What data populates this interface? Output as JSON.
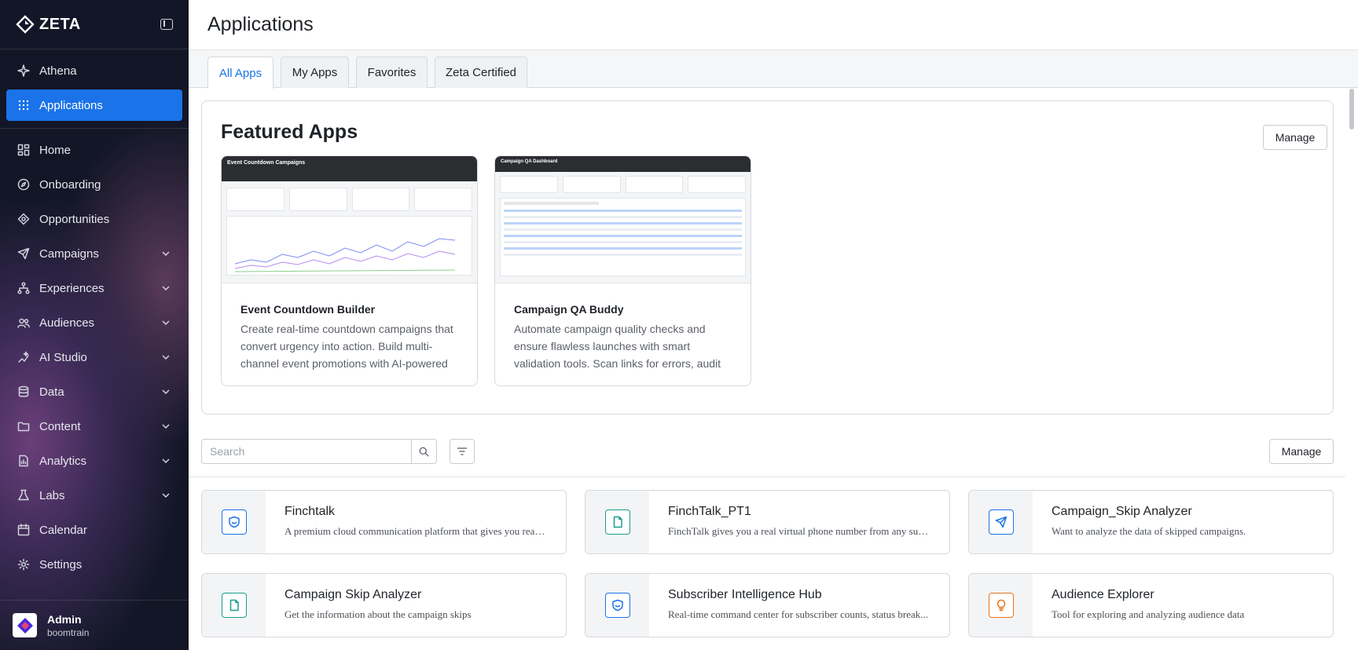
{
  "brand": {
    "name": "ZETA"
  },
  "sidebar": {
    "items": [
      {
        "label": "Athena",
        "icon": "sparkle-icon",
        "active": false,
        "expandable": false
      },
      {
        "label": "Applications",
        "icon": "grid-icon",
        "active": true,
        "expandable": false
      },
      {
        "label": "Home",
        "icon": "dashboard-icon",
        "active": false,
        "expandable": false
      },
      {
        "label": "Onboarding",
        "icon": "compass-icon",
        "active": false,
        "expandable": false
      },
      {
        "label": "Opportunities",
        "icon": "target-icon",
        "active": false,
        "expandable": false
      },
      {
        "label": "Campaigns",
        "icon": "send-icon",
        "active": false,
        "expandable": true
      },
      {
        "label": "Experiences",
        "icon": "flow-icon",
        "active": false,
        "expandable": true
      },
      {
        "label": "Audiences",
        "icon": "users-icon",
        "active": false,
        "expandable": true
      },
      {
        "label": "AI Studio",
        "icon": "ai-icon",
        "active": false,
        "expandable": true
      },
      {
        "label": "Data",
        "icon": "database-icon",
        "active": false,
        "expandable": true
      },
      {
        "label": "Content",
        "icon": "folder-icon",
        "active": false,
        "expandable": true
      },
      {
        "label": "Analytics",
        "icon": "report-icon",
        "active": false,
        "expandable": true
      },
      {
        "label": "Labs",
        "icon": "flask-icon",
        "active": false,
        "expandable": true
      },
      {
        "label": "Calendar",
        "icon": "calendar-icon",
        "active": false,
        "expandable": false
      },
      {
        "label": "Settings",
        "icon": "gear-icon",
        "active": false,
        "expandable": false
      }
    ],
    "user": {
      "name": "Admin",
      "org": "boomtrain"
    }
  },
  "header": {
    "title": "Applications"
  },
  "tabs": [
    {
      "label": "All Apps",
      "active": true
    },
    {
      "label": "My Apps",
      "active": false
    },
    {
      "label": "Favorites",
      "active": false
    },
    {
      "label": "Zeta Certified",
      "active": false
    }
  ],
  "featured": {
    "title": "Featured Apps",
    "manage_label": "Manage",
    "apps": [
      {
        "name": "Event Countdown Builder",
        "description": "Create real-time countdown campaigns that convert urgency into action. Build multi-channel event promotions with AI-powered",
        "thumb_title": "Event Countdown Campaigns"
      },
      {
        "name": "Campaign QA Buddy",
        "description": "Automate campaign quality checks and ensure flawless launches with smart validation tools. Scan links for errors, audit",
        "thumb_title": "Campaign QA Dashboard"
      }
    ]
  },
  "search": {
    "placeholder": "Search",
    "value": ""
  },
  "list_manage_label": "Manage",
  "apps": [
    {
      "name": "Finchtalk",
      "description": "A premium cloud communication platform that gives you real ...",
      "icon": "shield-icon",
      "color": "#1a73e8"
    },
    {
      "name": "FinchTalk_PT1",
      "description": "FinchTalk gives you a real virtual phone number from any supp...",
      "icon": "document-icon",
      "color": "#1a9c8c"
    },
    {
      "name": "Campaign_Skip Analyzer",
      "description": "Want to analyze the data of skipped campaigns.",
      "icon": "send-icon",
      "color": "#1a73e8"
    },
    {
      "name": "Campaign Skip Analyzer",
      "description": "Get the information about the campaign skips",
      "icon": "document-icon",
      "color": "#1a9c8c"
    },
    {
      "name": "Subscriber Intelligence Hub",
      "description": "Real-time command center for subscriber counts, status break...",
      "icon": "shield-icon",
      "color": "#1a73e8"
    },
    {
      "name": "Audience Explorer",
      "description": "Tool for exploring and analyzing audience data",
      "icon": "bulb-icon",
      "color": "#e8731a"
    }
  ],
  "colors": {
    "accent": "#1a73e8",
    "sidebar_bg": "#121626"
  }
}
